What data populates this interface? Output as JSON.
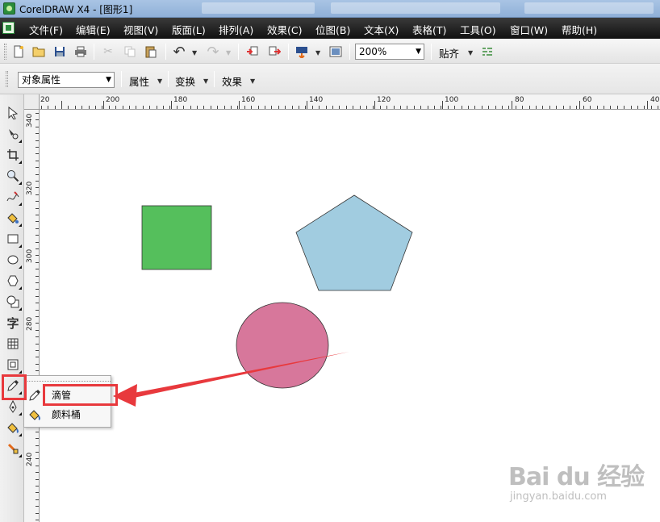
{
  "window": {
    "title": "CorelDRAW X4 - [图形1]"
  },
  "menu": [
    {
      "label": "文件(F)"
    },
    {
      "label": "编辑(E)"
    },
    {
      "label": "视图(V)"
    },
    {
      "label": "版面(L)"
    },
    {
      "label": "排列(A)"
    },
    {
      "label": "效果(C)"
    },
    {
      "label": "位图(B)"
    },
    {
      "label": "文本(X)"
    },
    {
      "label": "表格(T)"
    },
    {
      "label": "工具(O)"
    },
    {
      "label": "窗口(W)"
    },
    {
      "label": "帮助(H)"
    }
  ],
  "toolbar": {
    "zoom_value": "200%",
    "snap_label": "贴齐"
  },
  "property_bar": {
    "object_props": "对象属性",
    "attr_label": "属性",
    "transform_label": "变换",
    "effect_label": "效果"
  },
  "ruler_h": [
    "20",
    "200",
    "180",
    "160",
    "140",
    "120",
    "100",
    "80",
    "60",
    "40"
  ],
  "ruler_v": [
    "340",
    "320",
    "300",
    "280",
    "260",
    "240"
  ],
  "flyout": {
    "items": [
      {
        "label": "滴管",
        "icon": "eyedropper-icon"
      },
      {
        "label": "颜料桶",
        "icon": "paint-bucket-icon"
      }
    ]
  },
  "shapes": {
    "rectangle_color": "#55bf5c",
    "pentagon_color": "#a1cce0",
    "ellipse_color": "#d7779b",
    "highlight_color": "#e8393d"
  },
  "watermark": {
    "main": "Bai du 经验",
    "sub": "jingyan.baidu.com"
  }
}
